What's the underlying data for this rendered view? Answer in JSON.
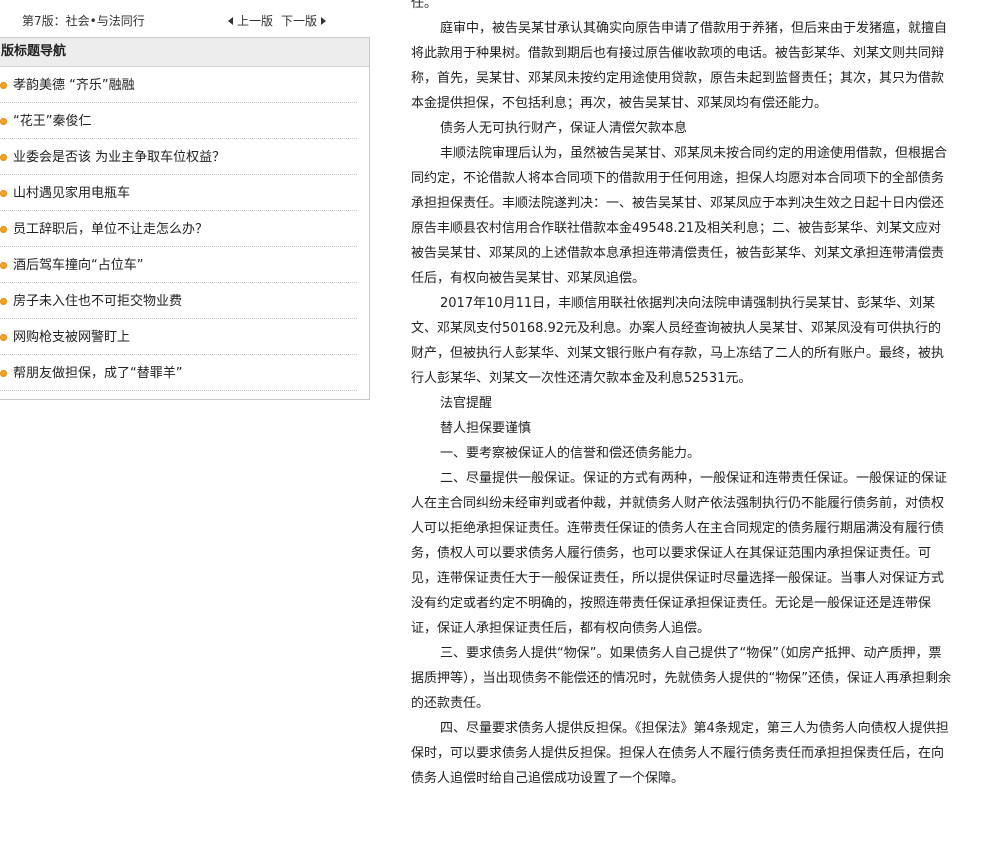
{
  "edition": {
    "page_no": "第7版：",
    "page_name": "社会•与法同行",
    "prev_label": "上一版",
    "next_label": "下一版"
  },
  "nav": {
    "header": "版标题导航",
    "items": [
      {
        "label": "孝韵美德 “齐乐”融融"
      },
      {
        "label": "“花王”秦俊仁"
      },
      {
        "label": "业委会是否该 为业主争取车位权益？"
      },
      {
        "label": "山村遇见家用电瓶车"
      },
      {
        "label": "员工辞职后，单位不让走怎么办？"
      },
      {
        "label": "酒后驾车撞向“占位车”"
      },
      {
        "label": "房子未入住也不可拒交物业费"
      },
      {
        "label": "网购枪支被网警盯上"
      },
      {
        "label": "帮朋友做担保，成了“替罪羊”"
      }
    ]
  },
  "article": {
    "paragraphs": [
      {
        "text": "任。",
        "indent": false
      },
      {
        "text": "庭审中，被告吴某甘承认其确实向原告申请了借款用于养猪，但后来由于发猪瘟，就擅自将此款用于种果树。借款到期后也有接过原告催收款项的电话。被告彭某华、刘某文则共同辩称，首先，吴某甘、邓某凤未按约定用途使用贷款，原告未起到监督责任；其次，其只为借款本金提供担保，不包括利息；再次，被告吴某甘、邓某凤均有偿还能力。",
        "indent": true
      },
      {
        "text": "债务人无可执行财产，保证人清偿欠款本息",
        "indent": true
      },
      {
        "text": "丰顺法院审理后认为，虽然被告吴某甘、邓某凤未按合同约定的用途使用借款，但根据合同约定，不论借款人将本合同项下的借款用于任何用途，担保人均愿对本合同项下的全部债务承担担保责任。丰顺法院遂判决：一、被告吴某甘、邓某凤应于本判决生效之日起十日内偿还原告丰顺县农村信用合作联社借款本金49548.21及相关利息；二、被告彭某华、刘某文应对被告吴某甘、邓某凤的上述借款本息承担连带清偿责任，被告彭某华、刘某文承担连带清偿责任后，有权向被告吴某甘、邓某凤追偿。",
        "indent": true
      },
      {
        "text": "2017年10月11日，丰顺信用联社依据判决向法院申请强制执行吴某甘、彭某华、刘某文、邓某凤支付50168.92元及利息。办案人员经查询被执人吴某甘、邓某凤没有可供执行的财产，但被执行人彭某华、刘某文银行账户有存款，马上冻结了二人的所有账户。最终，被执行人彭某华、刘某文一次性还清欠款本金及利息52531元。",
        "indent": true
      },
      {
        "text": "法官提醒",
        "indent": true
      },
      {
        "text": "替人担保要谨慎",
        "indent": true
      },
      {
        "text": "一、要考察被保证人的信誉和偿还债务能力。",
        "indent": true
      },
      {
        "text": "二、尽量提供一般保证。保证的方式有两种，一般保证和连带责任保证。一般保证的保证人在主合同纠纷未经审判或者仲裁，并就债务人财产依法强制执行仍不能履行债务前，对债权人可以拒绝承担保证责任。连带责任保证的债务人在主合同规定的债务履行期届满没有履行债务，债权人可以要求债务人履行债务，也可以要求保证人在其保证范围内承担保证责任。可见，连带保证责任大于一般保证责任，所以提供保证时尽量选择一般保证。当事人对保证方式没有约定或者约定不明确的，按照连带责任保证承担保证责任。无论是一般保证还是连带保证，保证人承担保证责任后，都有权向债务人追偿。",
        "indent": true
      },
      {
        "text": "三、要求债务人提供“物保”。如果债务人自己提供了“物保”（如房产抵押、动产质押，票据质押等），当出现债务不能偿还的情况时，先就债务人提供的“物保”还债，保证人再承担剩余的还款责任。",
        "indent": true
      },
      {
        "text": "四、尽量要求债务人提供反担保。《担保法》第4条规定，第三人为债务人向债权人提供担保时，可以要求债务人提供反担保。担保人在债务人不履行债务责任而承担担保责任后，在向债务人追偿时给自己追偿成功设置了一个保障。",
        "indent": true
      }
    ]
  }
}
